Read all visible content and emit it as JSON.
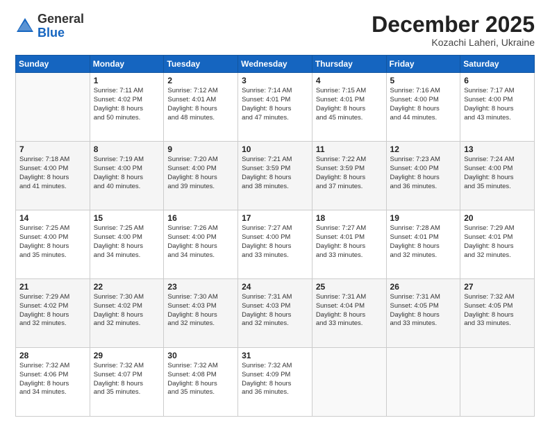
{
  "header": {
    "logo_general": "General",
    "logo_blue": "Blue",
    "month": "December 2025",
    "location": "Kozachi Laheri, Ukraine"
  },
  "days_of_week": [
    "Sunday",
    "Monday",
    "Tuesday",
    "Wednesday",
    "Thursday",
    "Friday",
    "Saturday"
  ],
  "weeks": [
    [
      {
        "day": "",
        "text": ""
      },
      {
        "day": "1",
        "text": "Sunrise: 7:11 AM\nSunset: 4:02 PM\nDaylight: 8 hours\nand 50 minutes."
      },
      {
        "day": "2",
        "text": "Sunrise: 7:12 AM\nSunset: 4:01 AM\nDaylight: 8 hours\nand 48 minutes."
      },
      {
        "day": "3",
        "text": "Sunrise: 7:14 AM\nSunset: 4:01 PM\nDaylight: 8 hours\nand 47 minutes."
      },
      {
        "day": "4",
        "text": "Sunrise: 7:15 AM\nSunset: 4:01 PM\nDaylight: 8 hours\nand 45 minutes."
      },
      {
        "day": "5",
        "text": "Sunrise: 7:16 AM\nSunset: 4:00 PM\nDaylight: 8 hours\nand 44 minutes."
      },
      {
        "day": "6",
        "text": "Sunrise: 7:17 AM\nSunset: 4:00 PM\nDaylight: 8 hours\nand 43 minutes."
      }
    ],
    [
      {
        "day": "7",
        "text": "Sunrise: 7:18 AM\nSunset: 4:00 PM\nDaylight: 8 hours\nand 41 minutes."
      },
      {
        "day": "8",
        "text": "Sunrise: 7:19 AM\nSunset: 4:00 PM\nDaylight: 8 hours\nand 40 minutes."
      },
      {
        "day": "9",
        "text": "Sunrise: 7:20 AM\nSunset: 4:00 PM\nDaylight: 8 hours\nand 39 minutes."
      },
      {
        "day": "10",
        "text": "Sunrise: 7:21 AM\nSunset: 3:59 PM\nDaylight: 8 hours\nand 38 minutes."
      },
      {
        "day": "11",
        "text": "Sunrise: 7:22 AM\nSunset: 3:59 PM\nDaylight: 8 hours\nand 37 minutes."
      },
      {
        "day": "12",
        "text": "Sunrise: 7:23 AM\nSunset: 4:00 PM\nDaylight: 8 hours\nand 36 minutes."
      },
      {
        "day": "13",
        "text": "Sunrise: 7:24 AM\nSunset: 4:00 PM\nDaylight: 8 hours\nand 35 minutes."
      }
    ],
    [
      {
        "day": "14",
        "text": "Sunrise: 7:25 AM\nSunset: 4:00 PM\nDaylight: 8 hours\nand 35 minutes."
      },
      {
        "day": "15",
        "text": "Sunrise: 7:25 AM\nSunset: 4:00 PM\nDaylight: 8 hours\nand 34 minutes."
      },
      {
        "day": "16",
        "text": "Sunrise: 7:26 AM\nSunset: 4:00 PM\nDaylight: 8 hours\nand 34 minutes."
      },
      {
        "day": "17",
        "text": "Sunrise: 7:27 AM\nSunset: 4:00 PM\nDaylight: 8 hours\nand 33 minutes."
      },
      {
        "day": "18",
        "text": "Sunrise: 7:27 AM\nSunset: 4:01 PM\nDaylight: 8 hours\nand 33 minutes."
      },
      {
        "day": "19",
        "text": "Sunrise: 7:28 AM\nSunset: 4:01 PM\nDaylight: 8 hours\nand 32 minutes."
      },
      {
        "day": "20",
        "text": "Sunrise: 7:29 AM\nSunset: 4:01 PM\nDaylight: 8 hours\nand 32 minutes."
      }
    ],
    [
      {
        "day": "21",
        "text": "Sunrise: 7:29 AM\nSunset: 4:02 PM\nDaylight: 8 hours\nand 32 minutes."
      },
      {
        "day": "22",
        "text": "Sunrise: 7:30 AM\nSunset: 4:02 PM\nDaylight: 8 hours\nand 32 minutes."
      },
      {
        "day": "23",
        "text": "Sunrise: 7:30 AM\nSunset: 4:03 PM\nDaylight: 8 hours\nand 32 minutes."
      },
      {
        "day": "24",
        "text": "Sunrise: 7:31 AM\nSunset: 4:03 PM\nDaylight: 8 hours\nand 32 minutes."
      },
      {
        "day": "25",
        "text": "Sunrise: 7:31 AM\nSunset: 4:04 PM\nDaylight: 8 hours\nand 33 minutes."
      },
      {
        "day": "26",
        "text": "Sunrise: 7:31 AM\nSunset: 4:05 PM\nDaylight: 8 hours\nand 33 minutes."
      },
      {
        "day": "27",
        "text": "Sunrise: 7:32 AM\nSunset: 4:05 PM\nDaylight: 8 hours\nand 33 minutes."
      }
    ],
    [
      {
        "day": "28",
        "text": "Sunrise: 7:32 AM\nSunset: 4:06 PM\nDaylight: 8 hours\nand 34 minutes."
      },
      {
        "day": "29",
        "text": "Sunrise: 7:32 AM\nSunset: 4:07 PM\nDaylight: 8 hours\nand 35 minutes."
      },
      {
        "day": "30",
        "text": "Sunrise: 7:32 AM\nSunset: 4:08 PM\nDaylight: 8 hours\nand 35 minutes."
      },
      {
        "day": "31",
        "text": "Sunrise: 7:32 AM\nSunset: 4:09 PM\nDaylight: 8 hours\nand 36 minutes."
      },
      {
        "day": "",
        "text": ""
      },
      {
        "day": "",
        "text": ""
      },
      {
        "day": "",
        "text": ""
      }
    ]
  ]
}
